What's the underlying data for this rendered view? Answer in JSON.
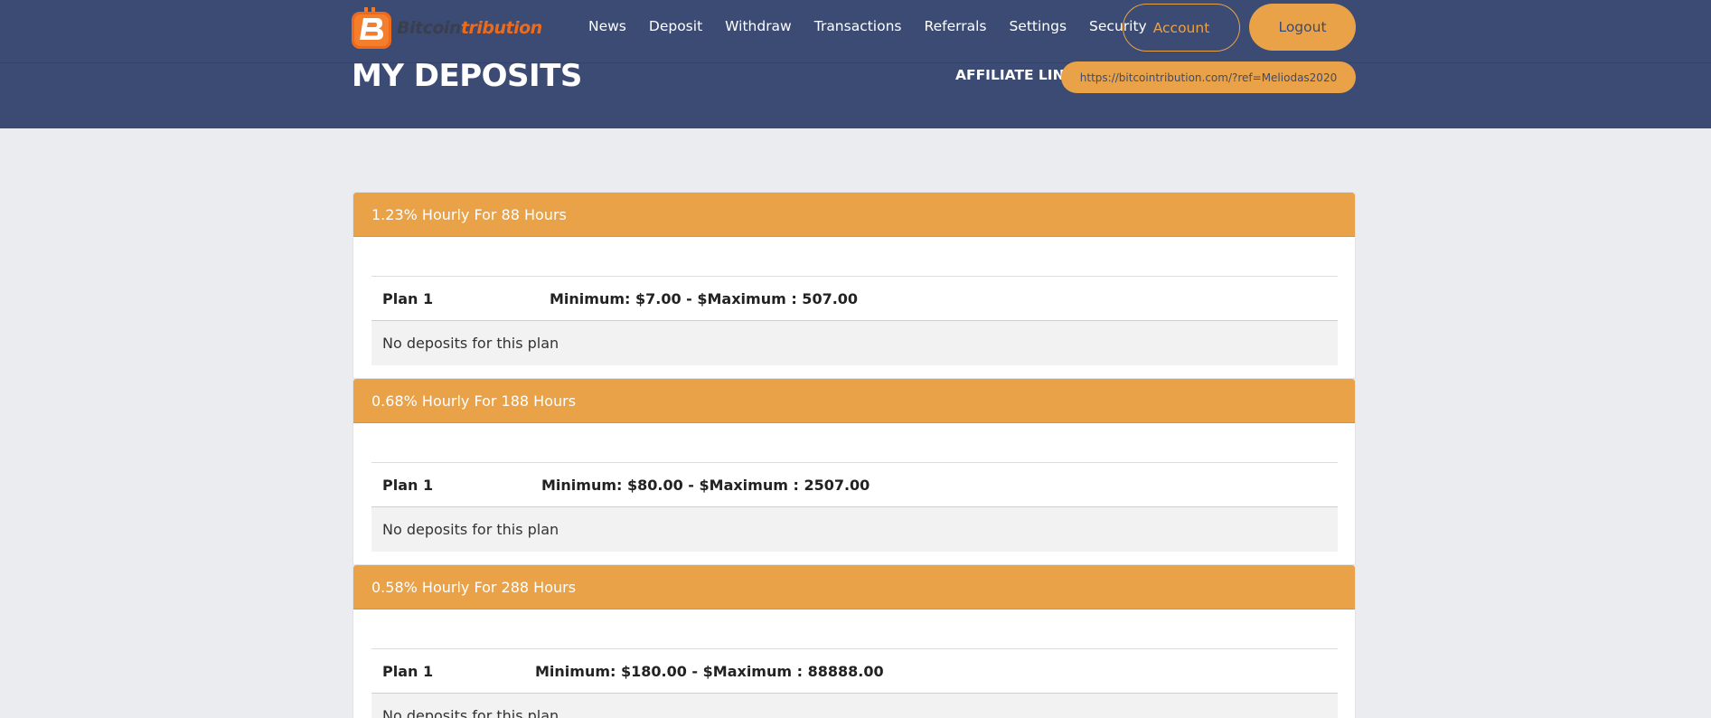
{
  "header": {
    "logo": {
      "part1": "Bitcoin",
      "part2": "tribution",
      "mark_letter": "B"
    },
    "nav": [
      "News",
      "Deposit",
      "Withdraw",
      "Transactions",
      "Referrals",
      "Settings",
      "Security"
    ],
    "account_label": "Account",
    "logout_label": "Logout",
    "page_title": "MY DEPOSITS",
    "affiliate_label": "AFFILIATE LINK:",
    "affiliate_url": "https://bitcointribution.com/?ref=Meliodas2020"
  },
  "plans": [
    {
      "title": "1.23% Hourly For 88 Hours",
      "plan": "Plan 1",
      "range": "Minimum: $7.00 - $Maximum : 507.00",
      "empty": "No deposits for this plan"
    },
    {
      "title": "0.68% Hourly For 188 Hours",
      "plan": "Plan 1",
      "range": "Minimum: $80.00 - $Maximum : 2507.00",
      "empty": "No deposits for this plan"
    },
    {
      "title": "0.58% Hourly For 288 Hours",
      "plan": "Plan 1",
      "range": "Minimum: $180.00 - $Maximum : 88888.00",
      "empty": "No deposits for this plan"
    }
  ],
  "colors": {
    "header_bg": "#3b4b74",
    "accent": "#e9a247",
    "logo_orange": "#ee6a1b",
    "page_bg": "#ebecef"
  },
  "icons": {
    "logo": "bitcointribution-logo-icon"
  }
}
